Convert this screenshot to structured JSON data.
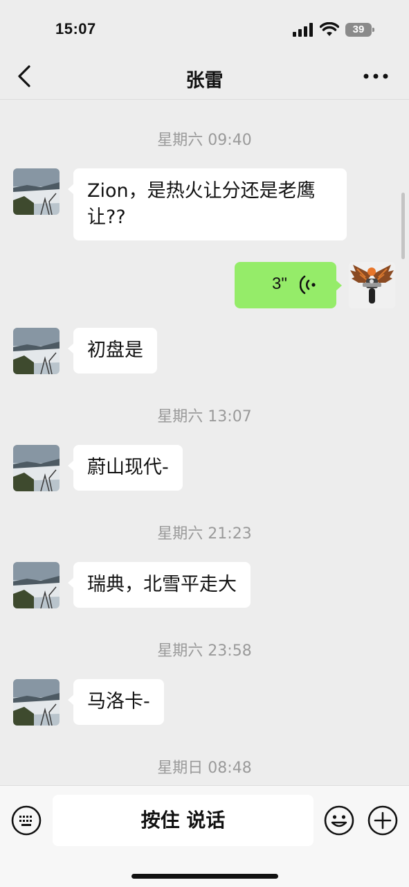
{
  "status_bar": {
    "time": "15:07",
    "battery": "39"
  },
  "nav": {
    "title": "张雷"
  },
  "messages": [
    {
      "type": "timestamp",
      "text": "星期六 09:40"
    },
    {
      "type": "text",
      "from": "contact",
      "text": "Zion，是热火让分还是老鹰让??"
    },
    {
      "type": "voice",
      "from": "me",
      "duration": "3\""
    },
    {
      "type": "text",
      "from": "contact",
      "text": "初盘是"
    },
    {
      "type": "timestamp",
      "text": "星期六 13:07"
    },
    {
      "type": "text",
      "from": "contact",
      "text": "蔚山现代-"
    },
    {
      "type": "timestamp",
      "text": "星期六 21:23"
    },
    {
      "type": "text",
      "from": "contact",
      "text": "瑞典，北雪平走大"
    },
    {
      "type": "timestamp",
      "text": "星期六 23:58"
    },
    {
      "type": "text",
      "from": "contact",
      "text": "马洛卡-"
    },
    {
      "type": "timestamp",
      "text": "星期日 08:48"
    }
  ],
  "input_bar": {
    "hold_to_talk_label": "按住 说话",
    "left_icon": "keyboard-icon",
    "right_icons": [
      "emoji-icon",
      "plus-icon"
    ]
  },
  "colors": {
    "background": "#ededed",
    "my_bubble": "#95ec69",
    "their_bubble": "#ffffff",
    "timestamp_text": "#9a9a9a"
  }
}
